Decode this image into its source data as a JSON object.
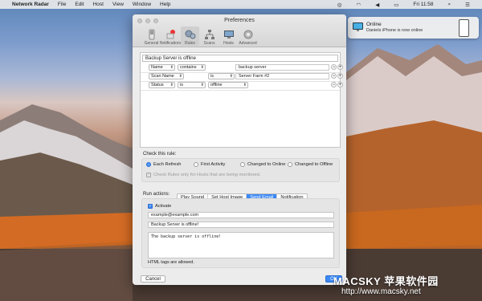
{
  "menubar": {
    "app_name": "Network Radar",
    "items": [
      "File",
      "Edit",
      "Host",
      "View",
      "Window",
      "Help"
    ],
    "time": "Fri 11:58"
  },
  "notification": {
    "title": "Online",
    "body": "Daniels iPhone is now online"
  },
  "window": {
    "title": "Preferences",
    "tabs": [
      {
        "label": "General",
        "icon": "switch-icon"
      },
      {
        "label": "Notifications",
        "icon": "bell-icon"
      },
      {
        "label": "Rules",
        "icon": "gears-icon"
      },
      {
        "label": "Scans",
        "icon": "network-icon"
      },
      {
        "label": "Hosts",
        "icon": "monitor-icon"
      },
      {
        "label": "Advanced",
        "icon": "gear-icon"
      }
    ],
    "selected_tab": "Rules",
    "rule_name": "Backup Server is offline",
    "conditions": [
      {
        "field": "Name",
        "operator": "contains",
        "value": "backup server"
      },
      {
        "field": "Scan Name",
        "operator": "is",
        "value": "Server Farm #2"
      },
      {
        "field": "Status",
        "operator": "is",
        "value": "offline"
      }
    ],
    "check_label": "Check this rule:",
    "check_options": [
      "Each Refresh",
      "First Activity",
      "Changed to Online",
      "Changed to Offline"
    ],
    "check_selected": "Each Refresh",
    "monitored_only": "Check Rules only for Hosts that are being monitored.",
    "run_actions_label": "Run actions:",
    "actions": [
      "Play Sound",
      "Set Host Image",
      "Send Email",
      "Notification"
    ],
    "action_selected": "Send Email",
    "activate_label": "Activate",
    "email_to": "example@example.com",
    "email_subject": "Backup Server is offline!",
    "email_body": "The backup server is offline!",
    "html_note": "HTML tags are allowed.",
    "cancel_label": "Cancel",
    "ok_label": "OK"
  },
  "watermark": {
    "brand": "MACSKY 苹果软件园",
    "url": "http://www.macsky.net"
  }
}
